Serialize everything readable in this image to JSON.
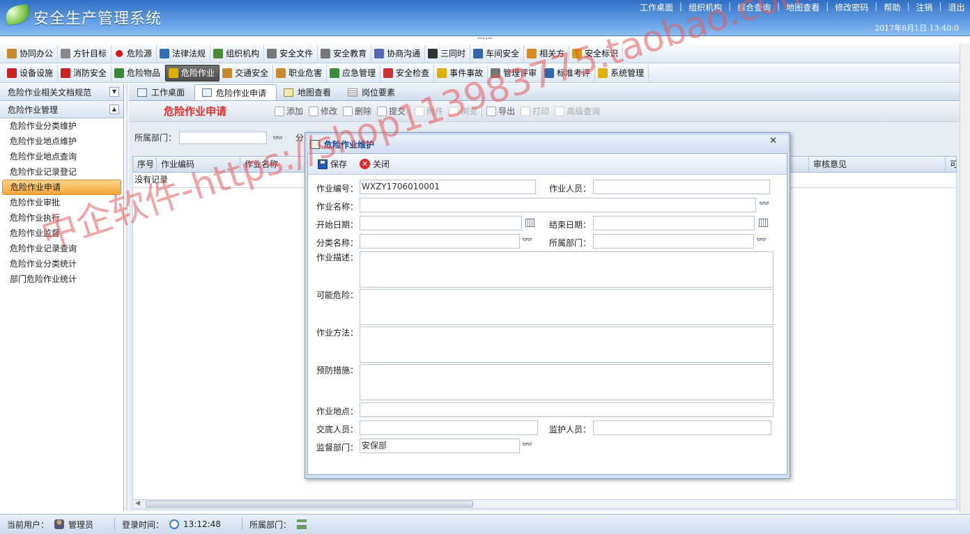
{
  "app": {
    "title": "安全生产管理系统",
    "datetime": "2017年6月1日 13:40:0"
  },
  "top_links": [
    "工作桌面",
    "组织机构",
    "综合查询",
    "地图查看",
    "修改密码",
    "帮助",
    "注销",
    "退出"
  ],
  "modules_row1": [
    {
      "label": "协同办公",
      "icon": "people-icon",
      "color": "#c98a2e"
    },
    {
      "label": "方针目标",
      "icon": "target-icon",
      "color": "#888888"
    },
    {
      "label": "危险源",
      "icon": "red-dot-icon",
      "color": "#dd1111"
    },
    {
      "label": "法律法规",
      "icon": "book-icon",
      "color": "#2f6fb8"
    },
    {
      "label": "组织机构",
      "icon": "org-chart-icon",
      "color": "#4a8a3a"
    },
    {
      "label": "安全文件",
      "icon": "document-icon",
      "color": "#777777"
    },
    {
      "label": "安全教育",
      "icon": "speech-bubble-icon",
      "color": "#777777"
    },
    {
      "label": "协商沟通",
      "icon": "envelope-icon",
      "color": "#5566bb"
    },
    {
      "label": "三同时",
      "icon": "list-icon",
      "color": "#333333"
    },
    {
      "label": "车间安全",
      "icon": "person-icon",
      "color": "#3366aa"
    },
    {
      "label": "相关方",
      "icon": "handshake-icon",
      "color": "#d98a20"
    },
    {
      "label": "安全标识",
      "icon": "flag-icon",
      "color": "#d6a000"
    }
  ],
  "modules_row2": [
    {
      "label": "设备设施",
      "icon": "equipment-icon",
      "color": "#cc2222"
    },
    {
      "label": "消防安全",
      "icon": "extinguisher-icon",
      "color": "#cc2222"
    },
    {
      "label": "危险物品",
      "icon": "flask-icon",
      "color": "#3a8a3a"
    },
    {
      "label": "危险作业",
      "icon": "hazard-icon",
      "color": "#e0b000",
      "active": true
    },
    {
      "label": "交通安全",
      "icon": "vehicle-icon",
      "color": "#c98a2e"
    },
    {
      "label": "职业危害",
      "icon": "worker-icon",
      "color": "#c98a2e"
    },
    {
      "label": "应急管理",
      "icon": "emergency-icon",
      "color": "#3a8a3a"
    },
    {
      "label": "安全检查",
      "icon": "magnifier-icon",
      "color": "#cc3333"
    },
    {
      "label": "事件事故",
      "icon": "warning-icon",
      "color": "#e0b000"
    },
    {
      "label": "管理评审",
      "icon": "review-icon",
      "color": "#777777"
    },
    {
      "label": "标准考评",
      "icon": "edit-icon",
      "color": "#3366aa"
    },
    {
      "label": "系统管理",
      "icon": "lock-icon",
      "color": "#e0b000"
    }
  ],
  "sidebar": {
    "section1": "危险作业相关文档规范",
    "section2": "危险作业管理",
    "items": [
      "危险作业分类维护",
      "危险作业地点维护",
      "危险作业地点查询",
      "危险作业记录登记",
      "危险作业申请",
      "危险作业审批",
      "危险作业执行",
      "危险作业监督",
      "危险作业记录查询",
      "危险作业分类统计",
      "部门危险作业统计"
    ],
    "selected": "危险作业申请"
  },
  "tabs": [
    "工作桌面",
    "危险作业申请",
    "地图查看",
    "岗位要素"
  ],
  "page": {
    "heading": "危险作业申请",
    "toolbar": [
      {
        "label": "添加",
        "icon": "add-icon",
        "disabled": false
      },
      {
        "label": "修改",
        "icon": "edit-icon",
        "disabled": false
      },
      {
        "label": "删除",
        "icon": "delete-icon",
        "disabled": false
      },
      {
        "label": "提交",
        "icon": "check-icon",
        "disabled": false
      },
      {
        "label": "附件",
        "icon": "attachment-icon",
        "disabled": true
      },
      {
        "label": "浏览",
        "icon": "browse-icon",
        "disabled": true
      },
      {
        "label": "导出",
        "icon": "export-icon",
        "disabled": false
      },
      {
        "label": "打印",
        "icon": "print-icon",
        "disabled": true
      },
      {
        "label": "高级查询",
        "icon": "query-icon",
        "disabled": true
      }
    ],
    "filter_label": "所属部门：",
    "filter_trailing": "分",
    "columns": [
      "序号",
      "作业编码",
      "作业名称",
      "审核意见",
      "可"
    ],
    "empty_text": "没有记录"
  },
  "modal": {
    "title": "危险作业维护",
    "save_label": "保存",
    "close_label": "关闭",
    "fields": {
      "code_label": "作业编号：",
      "code_value": "WXZY1706010001",
      "worker_label": "作业人员：",
      "name_label": "作业名称：",
      "start_label": "开始日期：",
      "end_label": "结束日期：",
      "category_label": "分类名称：",
      "dept_label": "所属部门：",
      "desc_label": "作业描述：",
      "risk_label": "可能危险：",
      "method_label": "作业方法：",
      "prevent_label": "预防措施：",
      "place_label": "作业地点：",
      "handover_label": "交底人员：",
      "guard_label": "监护人员：",
      "supervise_dept_label": "监督部门：",
      "supervise_dept_value": "安保部"
    }
  },
  "status": {
    "user_label": "当前用户：",
    "user_value": "管理员",
    "login_label": "登录时间：",
    "login_value": "13:12:48",
    "dept_label": "所属部门："
  },
  "watermark": "中企软件-https://shop113983775.taobao.com"
}
